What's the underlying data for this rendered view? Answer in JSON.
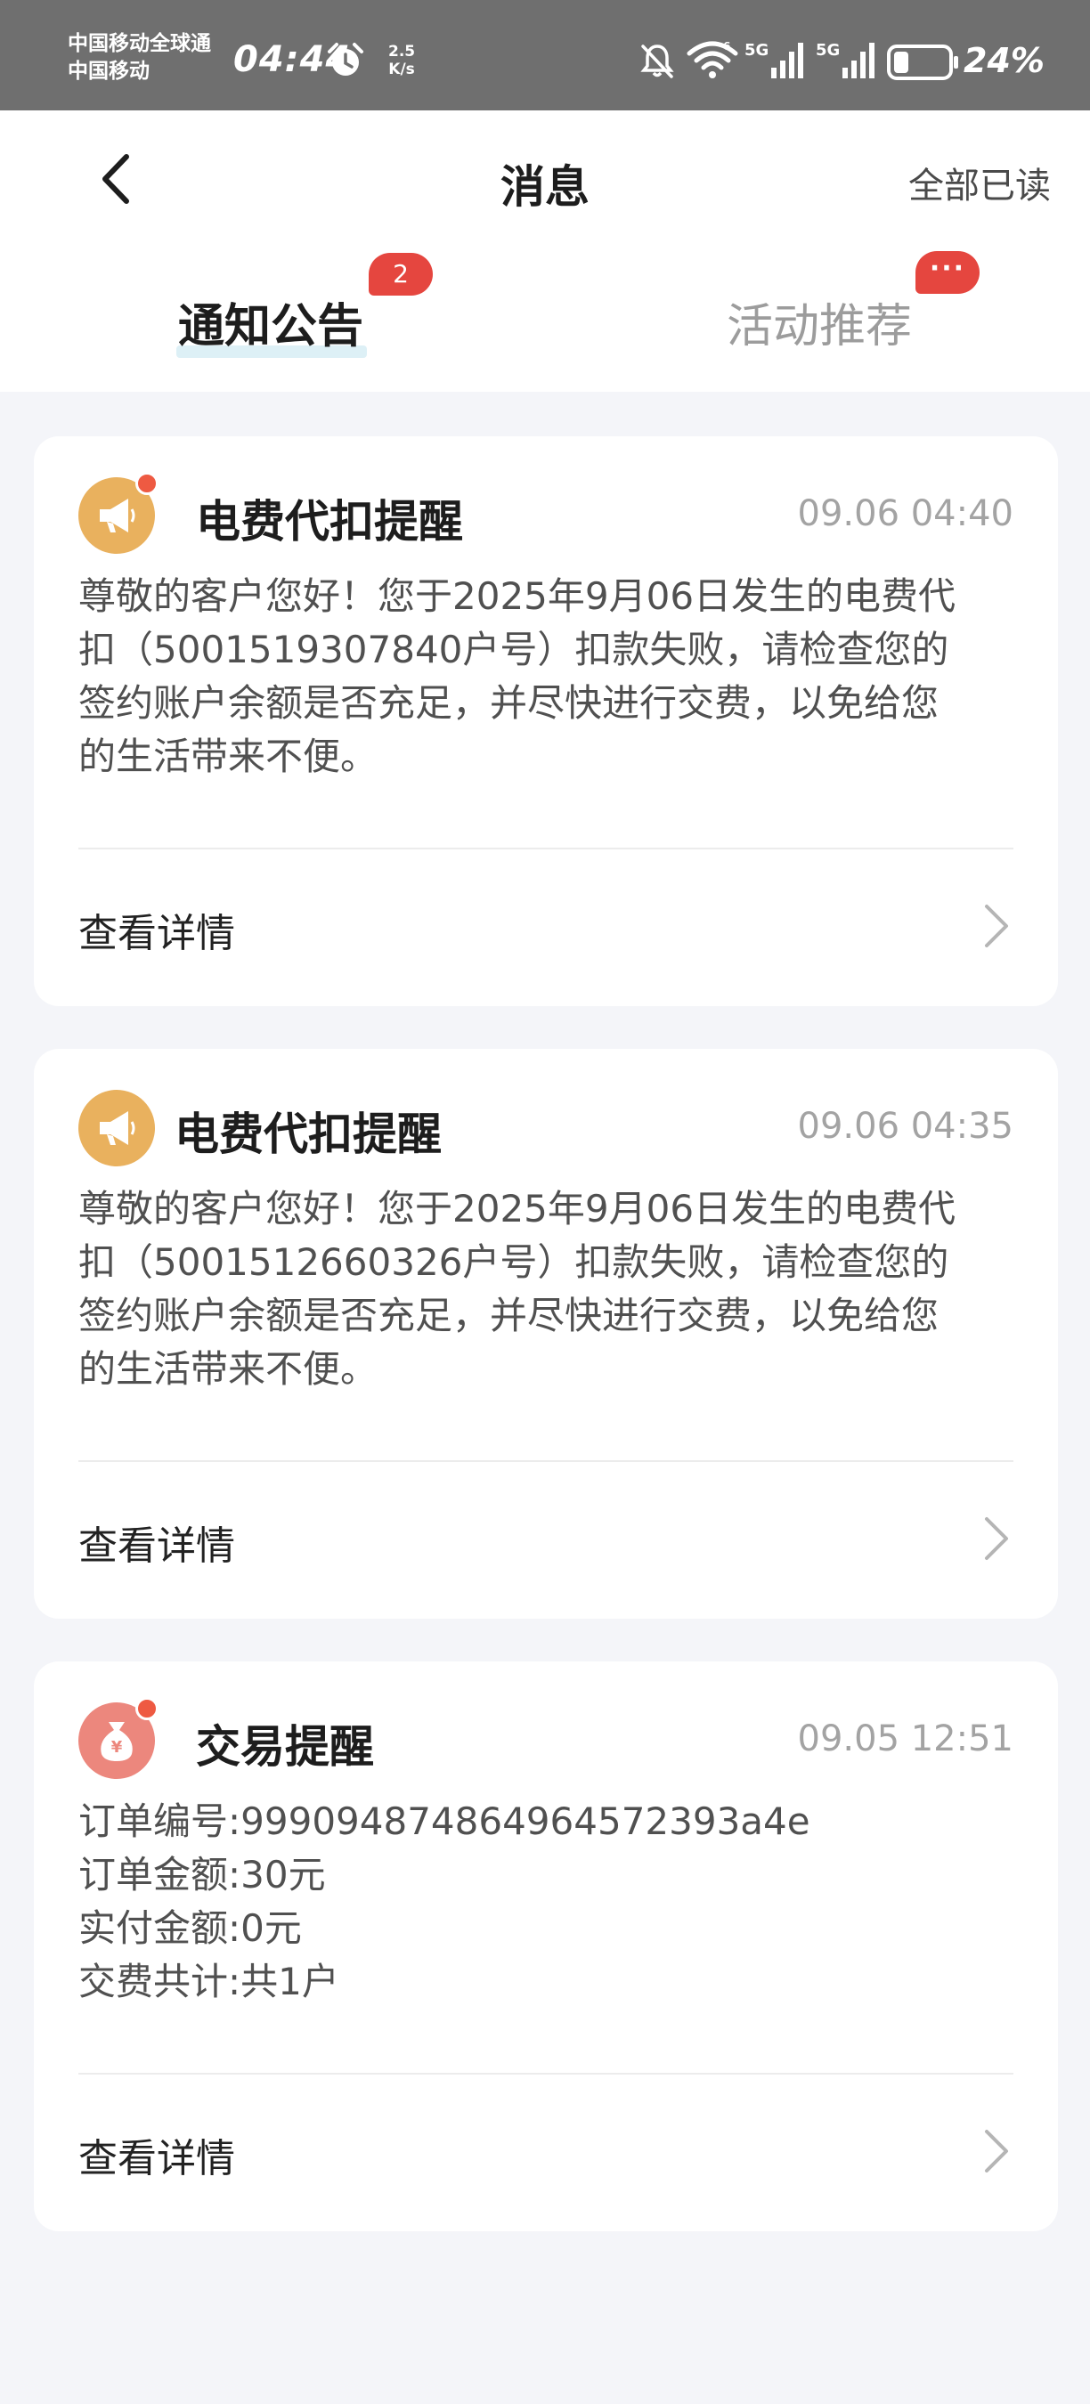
{
  "status_bar": {
    "carrier_line1": "中国移动全球通",
    "carrier_line2": "中国移动",
    "time": "04:44",
    "speed_value": "2.5",
    "speed_unit": "K/s",
    "network_type": "5G",
    "battery_percent": "24%"
  },
  "header": {
    "title": "消息",
    "mark_all_read": "全部已读"
  },
  "tabs": [
    {
      "label": "通知公告",
      "badge": "2",
      "active": true
    },
    {
      "label": "活动推荐",
      "badge": "···",
      "active": false
    }
  ],
  "messages": [
    {
      "title": "电费代扣提醒",
      "time": "09.06 04:40",
      "icon": "megaphone-icon",
      "unread": true,
      "body_lines": [
        "尊敬的客户您好！您于2025年9月06日发生的电费代",
        "扣（5001519307840户号）扣款失败，请检查您的",
        "签约账户余额是否充足，并尽快进行交费，以免给您",
        "的生活带来不便。"
      ],
      "detail_label": "查看详情"
    },
    {
      "title": "电费代扣提醒",
      "time": "09.06 04:35",
      "icon": "megaphone-icon",
      "unread": false,
      "body_lines": [
        "尊敬的客户您好！您于2025年9月06日发生的电费代",
        "扣（5001512660326户号）扣款失败，请检查您的",
        "签约账户余额是否充足，并尽快进行交费，以免给您",
        "的生活带来不便。"
      ],
      "detail_label": "查看详情"
    },
    {
      "title": "交易提醒",
      "time": "09.05 12:51",
      "icon": "money-bag-icon",
      "unread": true,
      "body_lines": [
        "订单编号:9990948748649645723​93a4e",
        "订单金额:30元",
        "实付金额:0元",
        "交费共计:共1户"
      ],
      "detail_label": "查看详情"
    }
  ],
  "colors": {
    "badge_red": "#e5463f",
    "icon_orange": "#e9b15e",
    "icon_pink": "#ec877d",
    "page_bg": "#f4f5f9"
  }
}
